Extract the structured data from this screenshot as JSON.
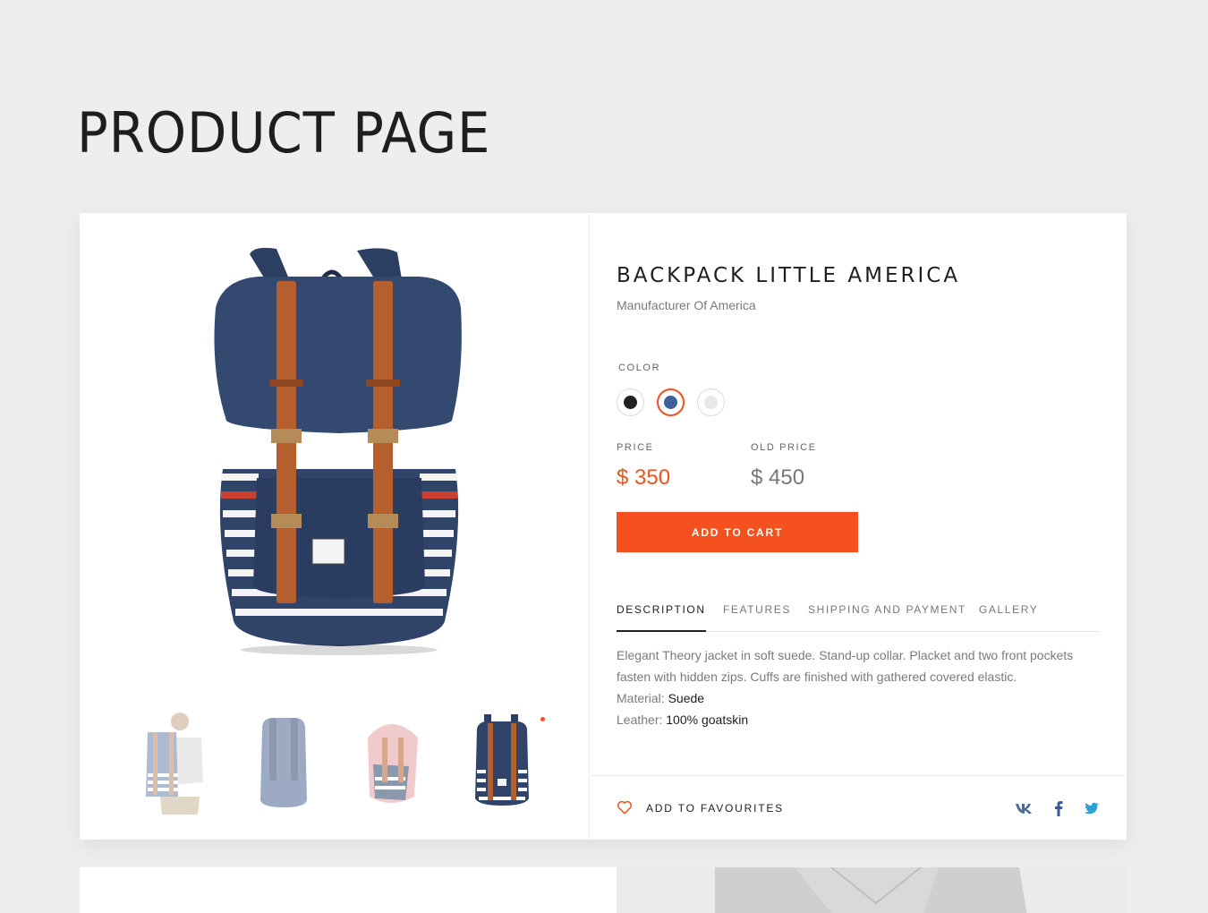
{
  "page": {
    "title": "PRODUCT PAGE"
  },
  "product": {
    "name": "BACKPACK LITTLE AMERICA",
    "manufacturer": "Manufacturer Of America",
    "color_label": "COLOR",
    "colors": [
      {
        "name": "black",
        "hex": "#222222",
        "selected": false
      },
      {
        "name": "blue",
        "hex": "#3f5f99",
        "selected": true
      },
      {
        "name": "white",
        "hex": "#e8e8e8",
        "selected": false
      }
    ],
    "price_label": "PRICE",
    "price": "$ 350",
    "old_price_label": "OLD PRICE",
    "old_price": "$ 450",
    "add_to_cart": "ADD TO CART"
  },
  "tabs": [
    {
      "label": "DESCRIPTION",
      "active": true
    },
    {
      "label": "FEATURES",
      "active": false
    },
    {
      "label": "SHIPPING AND PAYMENT",
      "active": false
    },
    {
      "label": "GALLERY",
      "active": false
    }
  ],
  "description": {
    "text": "Elegant Theory jacket in soft suede. Stand-up collar. Placket and two front pockets fasten with hidden zips. Cuffs are finished with gathered covered elastic.",
    "material_label": "Material:",
    "material_value": "Suede",
    "leather_label": "Leather:",
    "leather_value": "100% goatskin"
  },
  "footer": {
    "favourites": "ADD TO FAVOURITES",
    "social": [
      "vk-icon",
      "facebook-icon",
      "twitter-icon"
    ]
  },
  "colors": {
    "accent": "#f4511e",
    "navy": "#2f4468",
    "leather": "#b65f2e"
  }
}
